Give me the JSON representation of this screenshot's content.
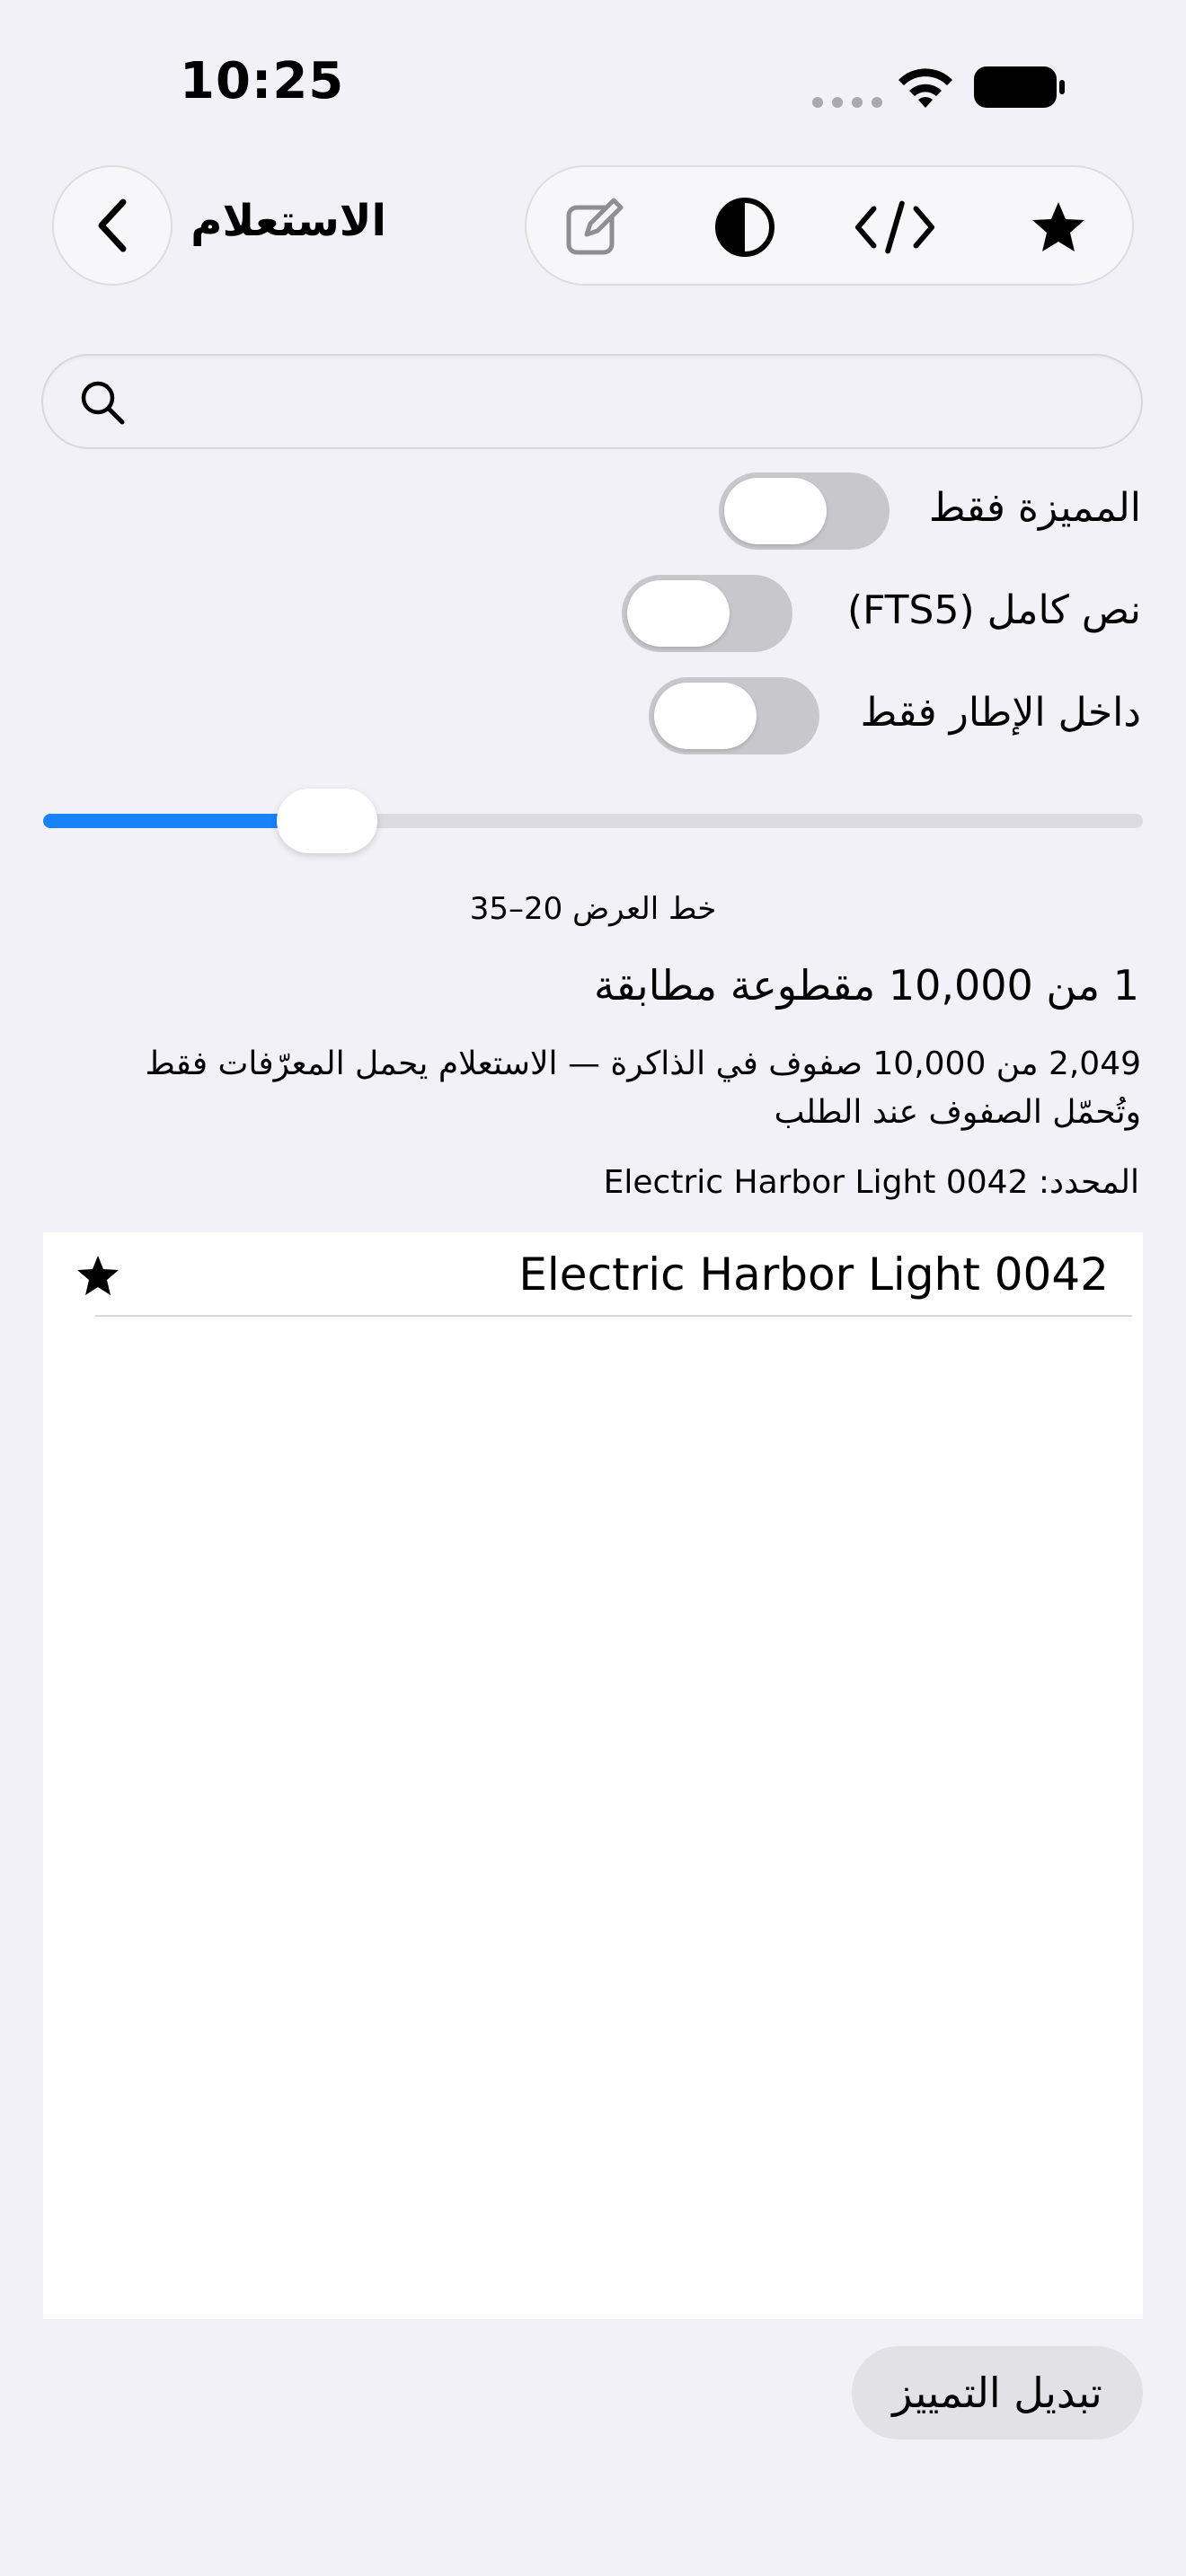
{
  "status_bar": {
    "time": "10:25",
    "icons": [
      "cellular-dots-icon",
      "wifi-icon",
      "battery-icon"
    ]
  },
  "nav": {
    "title": "الاستعلام",
    "back_icon": "chevron-left-icon",
    "toolbar_icons": [
      "compose-icon",
      "contrast-icon",
      "code-icon",
      "star-icon"
    ]
  },
  "search": {
    "value": "",
    "placeholder": ""
  },
  "toggles": [
    {
      "label": "المميزة فقط",
      "on": false
    },
    {
      "label": "نص كامل (FTS5)",
      "on": false
    },
    {
      "label": "داخل الإطار فقط",
      "on": false
    }
  ],
  "slider": {
    "caption": "خط العرض 20–35"
  },
  "results": {
    "match_count": "1 من 10,000 مقطوعة مطابقة",
    "rows_desc": "2,049 من 10,000 صفوف في الذاكرة — الاستعلام يحمل المعرّفات فقط وتُحمّل الصفوف عند الطلب",
    "selected": "المحدد: Electric Harbor Light 0042"
  },
  "list": {
    "items": [
      {
        "label": "Electric Harbor Light 0042",
        "starred": true
      }
    ]
  },
  "footer": {
    "toggle_highlight_label": "تبديل التمييز"
  },
  "colors": {
    "background": "#f2f1f7",
    "accent": "#1a82f7",
    "toggle_off": "#c7c7cc"
  }
}
